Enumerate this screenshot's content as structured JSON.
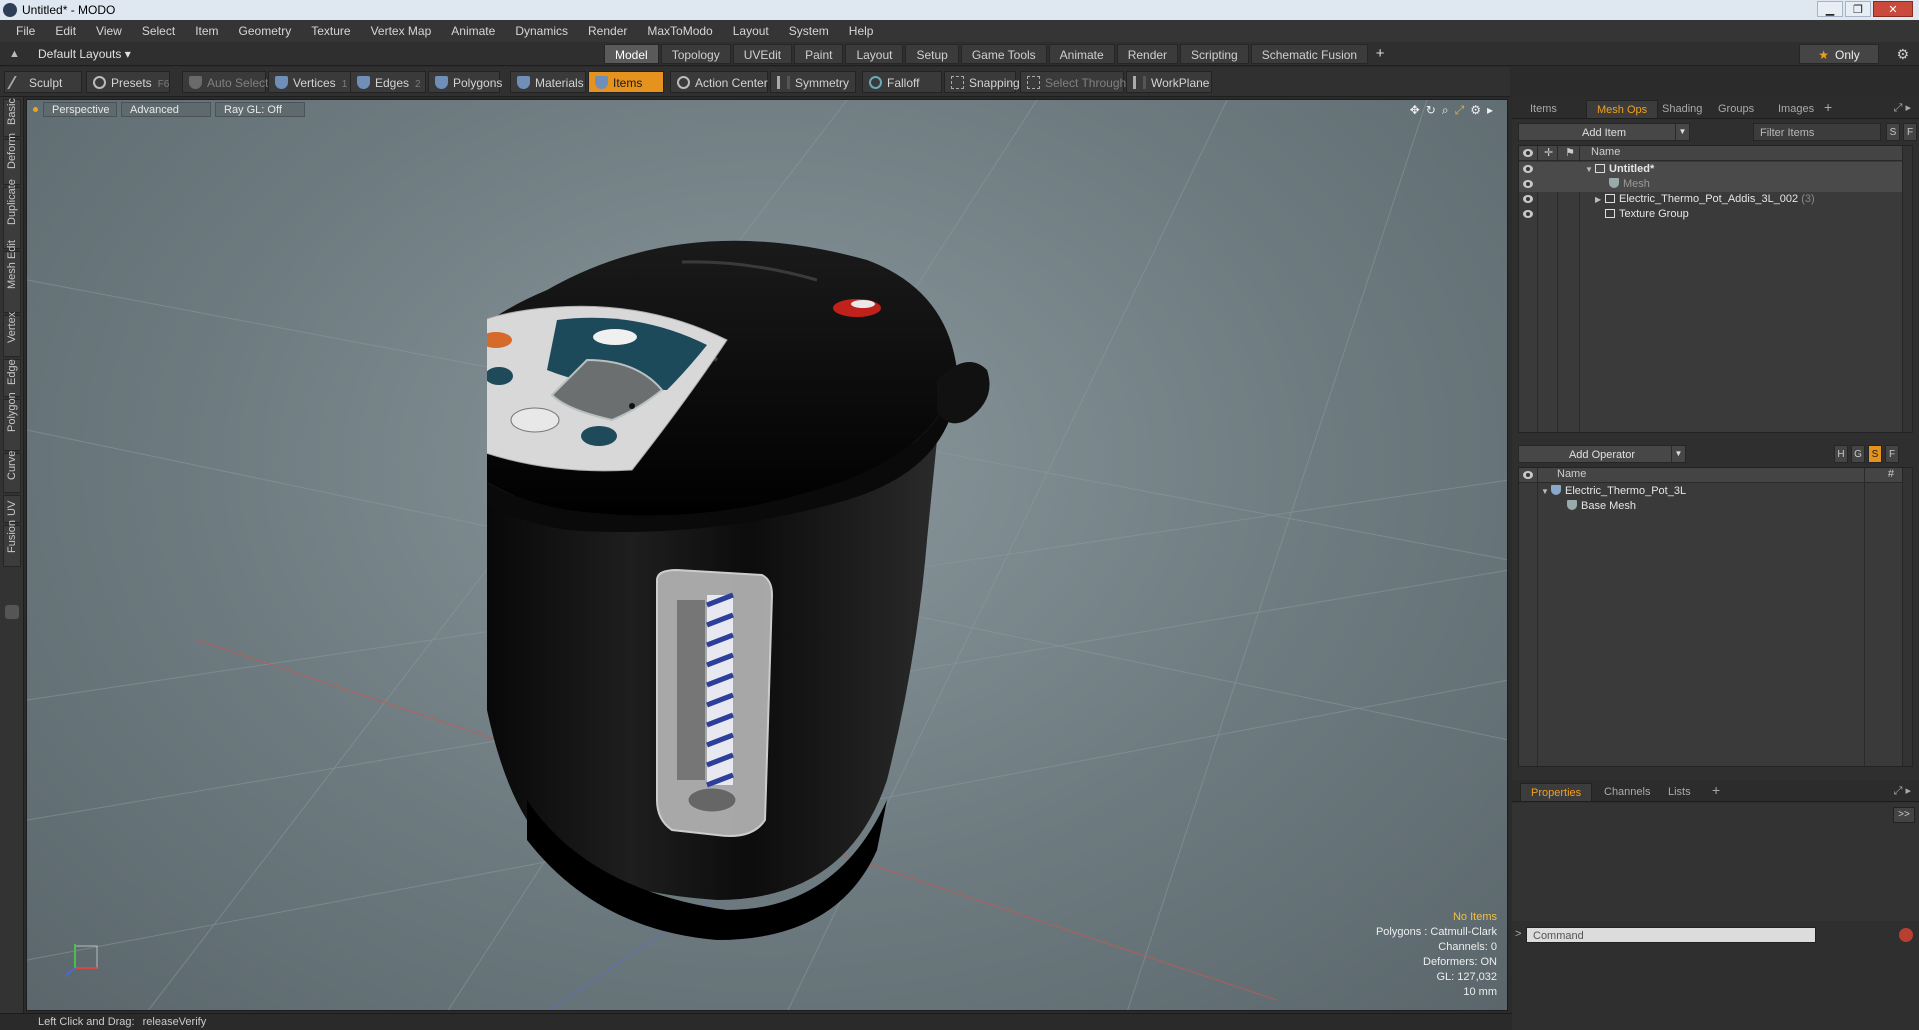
{
  "window": {
    "title": "Untitled* - MODO",
    "minimize": "▁",
    "maximize": "❐",
    "close": "✕"
  },
  "menu": [
    "File",
    "Edit",
    "View",
    "Select",
    "Item",
    "Geometry",
    "Texture",
    "Vertex Map",
    "Animate",
    "Dynamics",
    "Render",
    "MaxToModo",
    "Layout",
    "System",
    "Help"
  ],
  "layout": {
    "selector": "Default Layouts ▾",
    "only_label": "Only"
  },
  "tabs": [
    {
      "label": "Model",
      "active": true
    },
    {
      "label": "Topology"
    },
    {
      "label": "UVEdit"
    },
    {
      "label": "Paint"
    },
    {
      "label": "Layout"
    },
    {
      "label": "Setup"
    },
    {
      "label": "Game Tools"
    },
    {
      "label": "Animate"
    },
    {
      "label": "Render"
    },
    {
      "label": "Scripting"
    },
    {
      "label": "Schematic Fusion"
    }
  ],
  "toolbar": {
    "sculpt": "Sculpt",
    "presets": "Presets",
    "presets_key": "F6",
    "auto_select": "Auto Select",
    "vertices": "Vertices",
    "vertices_key": "1",
    "edges": "Edges",
    "edges_key": "2",
    "polygons": "Polygons",
    "materials": "Materials",
    "items": "Items",
    "action_center": "Action Center",
    "symmetry": "Symmetry",
    "falloff": "Falloff",
    "snapping": "Snapping",
    "select_through": "Select Through",
    "workplane": "WorkPlane"
  },
  "left_tabs": [
    "Basic",
    "Deform",
    "Duplicate",
    "Mesh Edit",
    "Vertex",
    "Edge",
    "Polygon",
    "Curve",
    "UV",
    "Fusion"
  ],
  "viewport": {
    "view": "Perspective",
    "style": "Advanced",
    "raygl": "Ray GL: Off",
    "info": {
      "items": "No Items",
      "polygons": "Polygons : Catmull-Clark",
      "channels": "Channels: 0",
      "deformers": "Deformers: ON",
      "gl": "GL: 127,032",
      "grid": "10 mm"
    }
  },
  "items_panel": {
    "tabs": [
      "Items",
      "Mesh Ops",
      "Shading",
      "Groups",
      "Images"
    ],
    "active_tab": "Mesh Ops",
    "add_item": "Add Item",
    "filter_placeholder": "Filter Items",
    "btn_s": "S",
    "btn_f": "F",
    "col_name": "Name",
    "rows": [
      {
        "label": "Untitled*",
        "bold": true
      },
      {
        "label": "Mesh",
        "dim": true
      },
      {
        "label": "Electric_Thermo_Pot_Addis_3L_002",
        "count": "(3)"
      },
      {
        "label": "Texture Group"
      }
    ]
  },
  "operators_panel": {
    "add_operator": "Add Operator",
    "btn_h": "H",
    "btn_g": "G",
    "btn_s": "S",
    "btn_f": "F",
    "col_name": "Name",
    "col_hash": "#",
    "rows": [
      {
        "label": "Electric_Thermo_Pot_3L"
      },
      {
        "label": "Base Mesh"
      }
    ]
  },
  "properties_panel": {
    "tabs": [
      "Properties",
      "Channels",
      "Lists"
    ],
    "active_tab": "Properties",
    "expand": ">>",
    "command_placeholder": "Command"
  },
  "status": {
    "label": "Left Click and Drag:",
    "value": "releaseVerify"
  },
  "colors": {
    "accent": "#e6921e",
    "viewport": "#7a878c"
  }
}
